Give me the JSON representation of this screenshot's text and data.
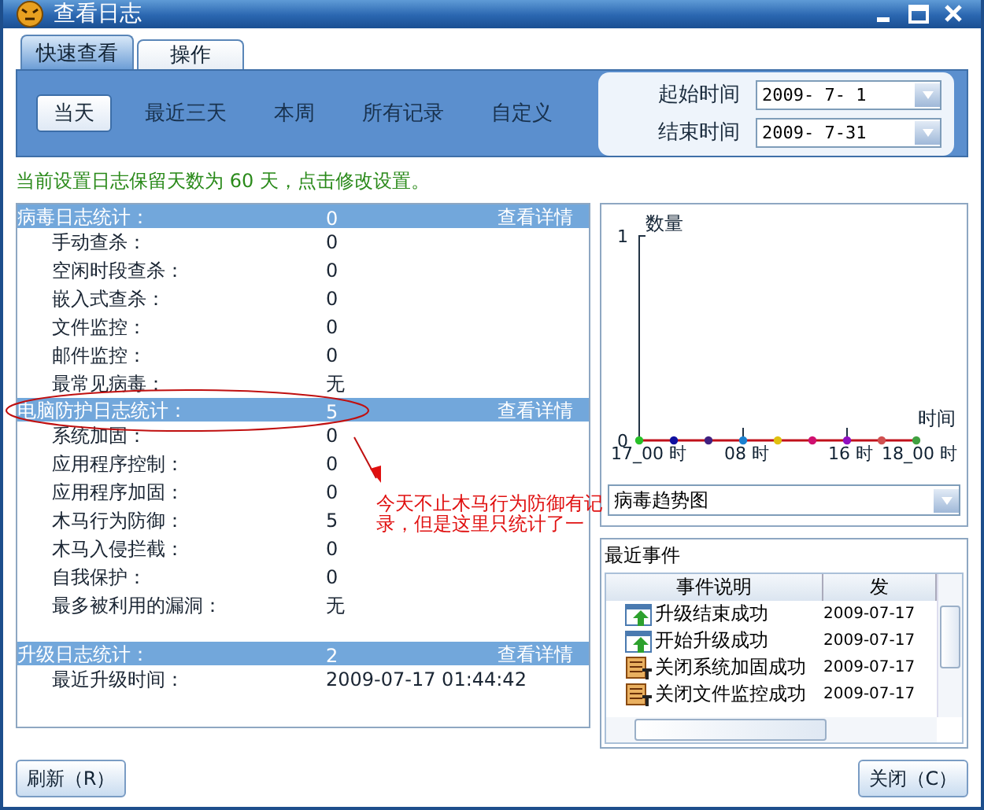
{
  "window": {
    "title": "查看日志"
  },
  "tabs": [
    {
      "label": "快速查看",
      "selected": true
    },
    {
      "label": "操作",
      "selected": false
    }
  ],
  "ranges": [
    {
      "label": "当天",
      "selected": true
    },
    {
      "label": "最近三天",
      "selected": false
    },
    {
      "label": "本周",
      "selected": false
    },
    {
      "label": "所有记录",
      "selected": false
    },
    {
      "label": "自定义",
      "selected": false
    }
  ],
  "date_fields": [
    {
      "label": "起始时间",
      "value": "2009- 7- 1"
    },
    {
      "label": "结束时间",
      "value": "2009- 7-31"
    }
  ],
  "retention_notice": "当前设置日志保留天数为 60 天，点击修改设置。",
  "sections": [
    {
      "title": "病毒日志统计：",
      "value": "0",
      "link": "查看详情",
      "items": [
        {
          "label": "手动查杀：",
          "value": "0"
        },
        {
          "label": "空闲时段查杀：",
          "value": "0"
        },
        {
          "label": "嵌入式查杀：",
          "value": "0"
        },
        {
          "label": "文件监控：",
          "value": "0"
        },
        {
          "label": "邮件监控：",
          "value": "0"
        },
        {
          "label": "最常见病毒：",
          "value": "无"
        }
      ]
    },
    {
      "title": "电脑防护日志统计：",
      "value": "5",
      "link": "查看详情",
      "circled": true,
      "items": [
        {
          "label": "系统加固：",
          "value": "0"
        },
        {
          "label": "应用程序控制：",
          "value": "0"
        },
        {
          "label": "应用程序加固：",
          "value": "0"
        },
        {
          "label": "木马行为防御：",
          "value": "5"
        },
        {
          "label": "木马入侵拦截：",
          "value": "0"
        },
        {
          "label": "自我保护：",
          "value": "0"
        },
        {
          "label": "最多被利用的漏洞：",
          "value": "无"
        }
      ]
    },
    {
      "title": "升级日志统计：",
      "value": "2",
      "link": "查看详情",
      "items": [
        {
          "label": "最近升级时间：",
          "value": "2009-07-17 01:44:42"
        }
      ]
    }
  ],
  "annotation": "今天不止木马行为防御有记录，但是这里只统计了一",
  "chart": {
    "chart_data": {
      "type": "line",
      "ylabel": "数量",
      "xlabel": "时间",
      "categories": [
        "17_00 时",
        null,
        null,
        "08 时",
        null,
        null,
        "16 时",
        null,
        "18_00 时"
      ],
      "yticks": [
        0,
        1
      ],
      "ylim": [
        0,
        1
      ],
      "series": [
        {
          "color": "#c0101a",
          "marker": "circle",
          "values": [
            0,
            0,
            0,
            0,
            0,
            0,
            0,
            0,
            0
          ]
        }
      ]
    },
    "selector": "病毒趋势图"
  },
  "events": {
    "title": "最近事件",
    "columns": [
      "事件说明",
      "发"
    ],
    "rows": [
      {
        "kind": "upgrade",
        "text": "升级结束成功",
        "time": "2009-07-17"
      },
      {
        "kind": "upgrade",
        "text": "开始升级成功",
        "time": "2009-07-17"
      },
      {
        "kind": "config",
        "text": "关闭系统加固成功",
        "time": "2009-07-17"
      },
      {
        "kind": "config",
        "text": "关闭文件监控成功",
        "time": "2009-07-17"
      }
    ]
  },
  "buttons": [
    {
      "label": "刷新（R）"
    },
    {
      "label": "关闭（C）"
    }
  ]
}
